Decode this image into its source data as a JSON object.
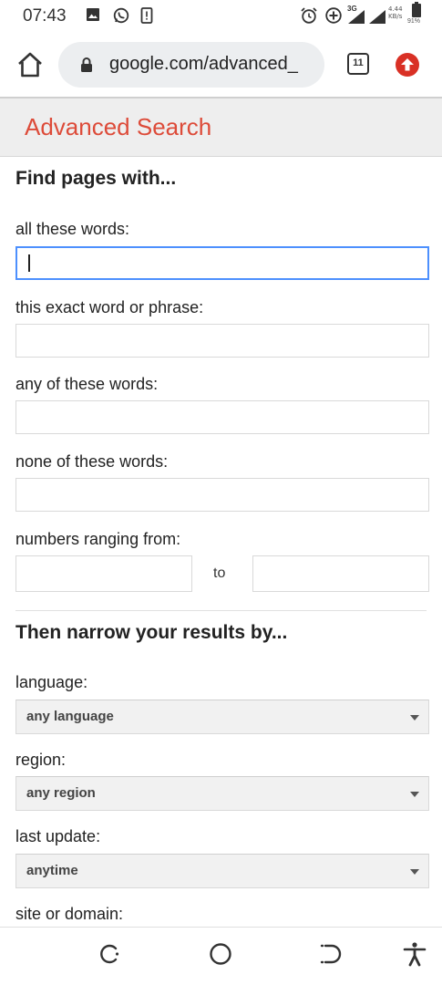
{
  "status_bar": {
    "time": "07:43",
    "network": "3G",
    "speed": "4.44",
    "speed_unit": "KB/s",
    "battery": "91%"
  },
  "browser": {
    "url": "google.com/advanced_",
    "tab_count": "11"
  },
  "page": {
    "title": "Advanced Search",
    "section1_title": "Find pages with...",
    "fields": [
      {
        "label": "all these words:",
        "value": ""
      },
      {
        "label": "this exact word or phrase:",
        "value": ""
      },
      {
        "label": "any of these words:",
        "value": ""
      },
      {
        "label": "none of these words:",
        "value": ""
      }
    ],
    "numbers_label": "numbers ranging from:",
    "to_label": "to",
    "section2_title": "Then narrow your results by...",
    "language_label": "language:",
    "language_value": "any language",
    "region_label": "region:",
    "region_value": "any region",
    "last_update_label": "last update:",
    "last_update_value": "anytime",
    "site_label": "site or domain:"
  },
  "colors": {
    "accent_red": "#dd4b39",
    "focus_blue": "#4d90fe",
    "update_red": "#d93025"
  }
}
